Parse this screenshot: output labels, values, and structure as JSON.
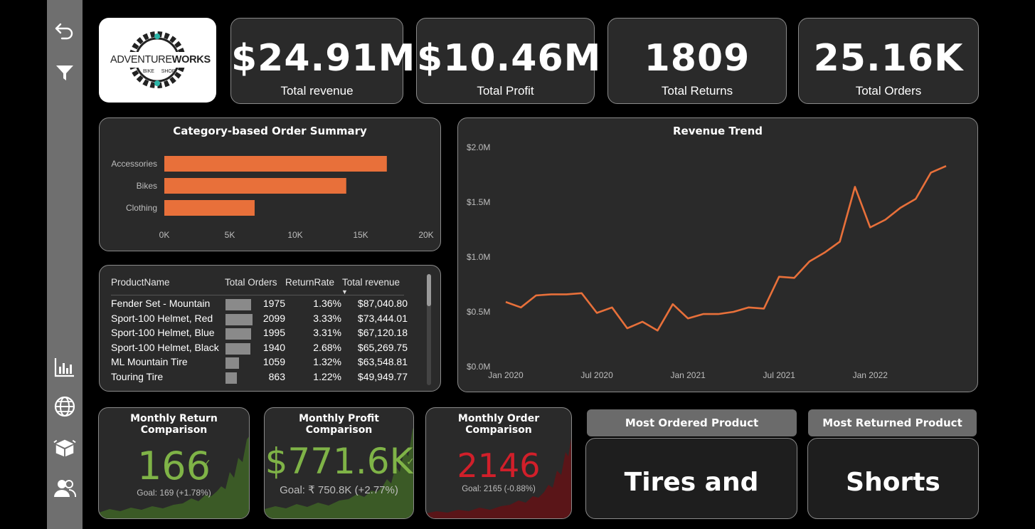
{
  "sidebar": {
    "items": [
      {
        "label": "back-icon"
      },
      {
        "label": "filter-icon"
      },
      {
        "label": "bar-chart-icon"
      },
      {
        "label": "globe-icon"
      },
      {
        "label": "box-icon"
      },
      {
        "label": "users-icon"
      }
    ]
  },
  "logo": {
    "brand_left": "ADVENTURE",
    "brand_right": "WORKS",
    "sub_left": "BIKE",
    "sub_right": "SHOP"
  },
  "kpis": [
    {
      "value": "$24.91M",
      "label": "Total revenue"
    },
    {
      "value": "$10.46M",
      "label": "Total Profit"
    },
    {
      "value": "1809",
      "label": "Total Returns"
    },
    {
      "value": "25.16K",
      "label": "Total Orders"
    }
  ],
  "category_chart": {
    "title": "Category-based Order Summary",
    "bar_color": "#e8703a"
  },
  "revenue_chart": {
    "title": "Revenue Trend",
    "line_color": "#e8703a"
  },
  "chart_data": [
    {
      "type": "bar",
      "orientation": "horizontal",
      "title": "Category-based Order Summary",
      "categories": [
        "Accessories",
        "Bikes",
        "Clothing"
      ],
      "values": [
        17000,
        13900,
        6900
      ],
      "xlim": [
        0,
        20000
      ],
      "x_ticks": [
        "0K",
        "5K",
        "10K",
        "15K",
        "20K"
      ]
    },
    {
      "type": "line",
      "title": "Revenue Trend",
      "x": [
        "2020-01",
        "2020-02",
        "2020-03",
        "2020-04",
        "2020-05",
        "2020-06",
        "2020-07",
        "2020-08",
        "2020-09",
        "2020-10",
        "2020-11",
        "2020-12",
        "2021-01",
        "2021-02",
        "2021-03",
        "2021-04",
        "2021-05",
        "2021-06",
        "2021-07",
        "2021-08",
        "2021-09",
        "2021-10",
        "2021-11",
        "2021-12",
        "2022-01",
        "2022-02",
        "2022-03",
        "2022-04",
        "2022-05",
        "2022-06"
      ],
      "y": [
        0.59,
        0.54,
        0.65,
        0.66,
        0.66,
        0.67,
        0.49,
        0.54,
        0.35,
        0.41,
        0.33,
        0.57,
        0.44,
        0.48,
        0.48,
        0.5,
        0.54,
        0.53,
        0.82,
        0.81,
        0.96,
        1.04,
        1.14,
        1.64,
        1.27,
        1.34,
        1.45,
        1.53,
        1.77,
        1.83
      ],
      "ylim": [
        0,
        2.0
      ],
      "y_ticks": [
        "$0.0M",
        "$0.5M",
        "$1.0M",
        "$1.5M",
        "$2.0M"
      ],
      "x_ticks": [
        {
          "label": "Jan 2020",
          "at": "2020-01"
        },
        {
          "label": "Jul 2020",
          "at": "2020-07"
        },
        {
          "label": "Jan 2021",
          "at": "2021-01"
        },
        {
          "label": "Jul 2021",
          "at": "2021-07"
        },
        {
          "label": "Jan 2022",
          "at": "2022-01"
        }
      ]
    }
  ],
  "product_table": {
    "headers": [
      "ProductName",
      "Total Orders",
      "ReturnRate",
      "Total revenue"
    ],
    "rows": [
      {
        "name": "Fender Set - Mountain",
        "orders": "1975",
        "orders_num": 1975,
        "rate": "1.36%",
        "revenue": "$87,040.80"
      },
      {
        "name": "Sport-100 Helmet, Red",
        "orders": "2099",
        "orders_num": 2099,
        "rate": "3.33%",
        "revenue": "$73,444.01"
      },
      {
        "name": "Sport-100 Helmet, Blue",
        "orders": "1995",
        "orders_num": 1995,
        "rate": "3.31%",
        "revenue": "$67,120.18"
      },
      {
        "name": "Sport-100 Helmet, Black",
        "orders": "1940",
        "orders_num": 1940,
        "rate": "2.68%",
        "revenue": "$65,269.75"
      },
      {
        "name": "ML Mountain Tire",
        "orders": "1059",
        "orders_num": 1059,
        "rate": "1.32%",
        "revenue": "$63,548.81"
      },
      {
        "name": "Touring Tire",
        "orders": "863",
        "orders_num": 863,
        "rate": "1.22%",
        "revenue": "$49,949.77"
      }
    ]
  },
  "comparisons": [
    {
      "title": "Monthly Return Comparison",
      "value": "166",
      "goal": "Goal: 169 (+1.78%)",
      "color": "#7fb347",
      "fill": "#3b5a26"
    },
    {
      "title": "Monthly Profit Comparison",
      "value": "$771.6K",
      "goal": "Goal: ₹ 750.8K (+2.77%)",
      "color": "#7fb347",
      "fill": "#3b5a26"
    },
    {
      "title": "Monthly Order Comparison",
      "value": "2146",
      "goal": "Goal: 2165 (-0.88%)",
      "color": "#d11f2a",
      "fill": "#5a1518"
    }
  ],
  "most_ordered": {
    "header": "Most Ordered Product",
    "value": "Tires and Tubes"
  },
  "most_returned": {
    "header": "Most Returned Product",
    "value": "Shorts"
  }
}
